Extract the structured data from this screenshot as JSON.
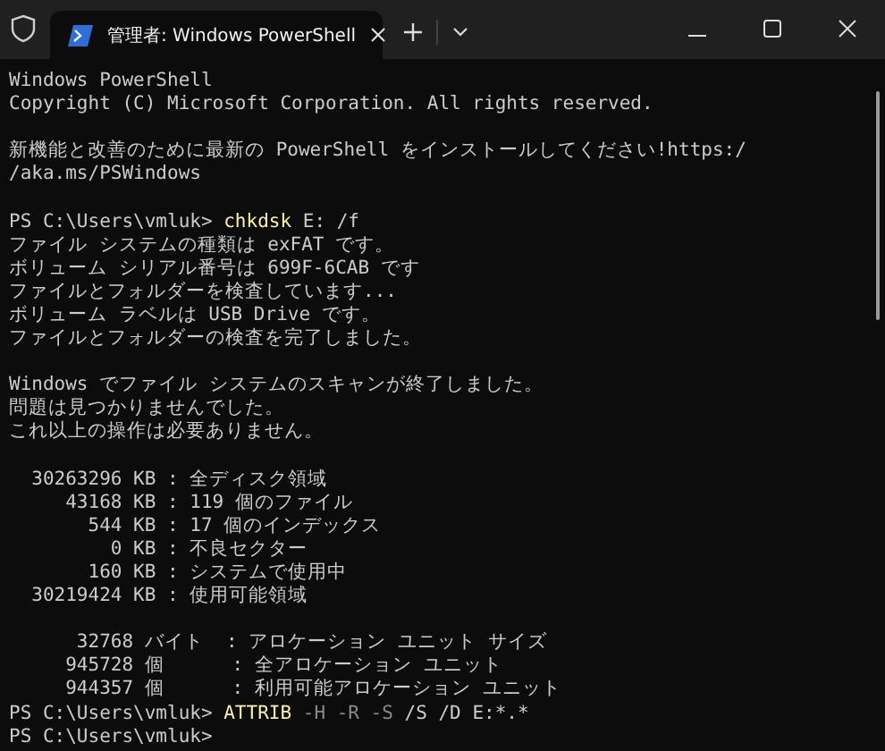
{
  "window": {
    "tab_title": "管理者: Windows PowerShell"
  },
  "lines": [
    {
      "kind": "text",
      "segments": [
        {
          "kind": "plain",
          "text": "Windows PowerShell"
        }
      ]
    },
    {
      "kind": "text",
      "segments": [
        {
          "kind": "plain",
          "text": "Copyright (C) Microsoft Corporation. All rights reserved."
        }
      ]
    },
    {
      "kind": "blank"
    },
    {
      "kind": "text",
      "segments": [
        {
          "kind": "plain",
          "text": "新機能と改善のために最新の PowerShell をインストールしてください!https:/"
        }
      ]
    },
    {
      "kind": "text",
      "segments": [
        {
          "kind": "plain",
          "text": "/aka.ms/PSWindows"
        }
      ]
    },
    {
      "kind": "blank"
    },
    {
      "kind": "text",
      "segments": [
        {
          "kind": "plain",
          "text": "PS C:\\Users\\vmluk> "
        },
        {
          "kind": "command",
          "text": "chkdsk"
        },
        {
          "kind": "plain",
          "text": " E: /f"
        }
      ]
    },
    {
      "kind": "text",
      "segments": [
        {
          "kind": "plain",
          "text": "ファイル システムの種類は exFAT です。"
        }
      ]
    },
    {
      "kind": "text",
      "segments": [
        {
          "kind": "plain",
          "text": "ボリューム シリアル番号は 699F-6CAB です"
        }
      ]
    },
    {
      "kind": "text",
      "segments": [
        {
          "kind": "plain",
          "text": "ファイルとフォルダーを検査しています..."
        }
      ]
    },
    {
      "kind": "text",
      "segments": [
        {
          "kind": "plain",
          "text": "ボリューム ラベルは USB Drive です。"
        }
      ]
    },
    {
      "kind": "text",
      "segments": [
        {
          "kind": "plain",
          "text": "ファイルとフォルダーの検査を完了しました。"
        }
      ]
    },
    {
      "kind": "blank"
    },
    {
      "kind": "text",
      "segments": [
        {
          "kind": "plain",
          "text": "Windows でファイル システムのスキャンが終了しました。"
        }
      ]
    },
    {
      "kind": "text",
      "segments": [
        {
          "kind": "plain",
          "text": "問題は見つかりませんでした。"
        }
      ]
    },
    {
      "kind": "text",
      "segments": [
        {
          "kind": "plain",
          "text": "これ以上の操作は必要ありません。"
        }
      ]
    },
    {
      "kind": "blank"
    },
    {
      "kind": "text",
      "segments": [
        {
          "kind": "plain",
          "text": "  30263296 KB : 全ディスク領域"
        }
      ]
    },
    {
      "kind": "text",
      "segments": [
        {
          "kind": "plain",
          "text": "     43168 KB : 119 個のファイル"
        }
      ]
    },
    {
      "kind": "text",
      "segments": [
        {
          "kind": "plain",
          "text": "       544 KB : 17 個のインデックス"
        }
      ]
    },
    {
      "kind": "text",
      "segments": [
        {
          "kind": "plain",
          "text": "         0 KB : 不良セクター"
        }
      ]
    },
    {
      "kind": "text",
      "segments": [
        {
          "kind": "plain",
          "text": "       160 KB : システムで使用中"
        }
      ]
    },
    {
      "kind": "text",
      "segments": [
        {
          "kind": "plain",
          "text": "  30219424 KB : 使用可能領域"
        }
      ]
    },
    {
      "kind": "blank"
    },
    {
      "kind": "text",
      "segments": [
        {
          "kind": "plain",
          "text": "      32768 バイト  : アロケーション ユニット サイズ"
        }
      ]
    },
    {
      "kind": "text",
      "segments": [
        {
          "kind": "plain",
          "text": "     945728 個      : 全アロケーション ユニット"
        }
      ]
    },
    {
      "kind": "text",
      "segments": [
        {
          "kind": "plain",
          "text": "     944357 個      : 利用可能アロケーション ユニット"
        }
      ]
    },
    {
      "kind": "text",
      "segments": [
        {
          "kind": "plain",
          "text": "PS C:\\Users\\vmluk> "
        },
        {
          "kind": "command",
          "text": "ATTRIB"
        },
        {
          "kind": "flag",
          "text": " -H -R -S"
        },
        {
          "kind": "plain",
          "text": " /S /D E:*.*"
        }
      ]
    },
    {
      "kind": "text",
      "segments": [
        {
          "kind": "plain",
          "text": "PS C:\\Users\\vmluk>"
        }
      ]
    }
  ]
}
